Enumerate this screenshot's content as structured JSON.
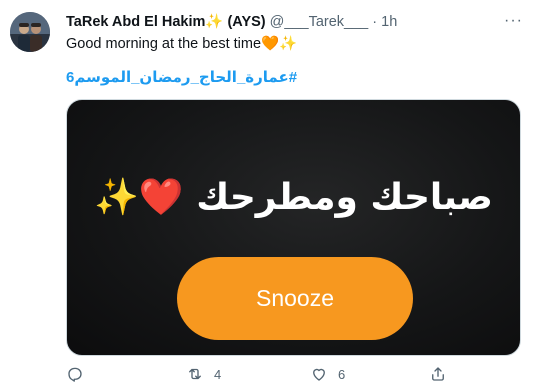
{
  "author": {
    "display_name": "TaRek Abd El Hakim✨ (AYS)",
    "handle": "@___Tarek___",
    "separator": "·",
    "time": "1h"
  },
  "more_label": "···",
  "tweet": {
    "text": "Good morning at the best time🧡✨",
    "hashtag": "#عمارة_الحاج_رمضان_الموسم6"
  },
  "media": {
    "caption": "صباحك ومطرحك ❤️✨",
    "button_label": "Snooze",
    "button_color": "#f7981f"
  },
  "actions": {
    "reply": {
      "icon": "reply-icon",
      "count": ""
    },
    "retweet": {
      "icon": "retweet-icon",
      "count": "4"
    },
    "like": {
      "icon": "heart-icon",
      "count": "6"
    },
    "share": {
      "icon": "share-icon",
      "count": ""
    }
  },
  "colors": {
    "accent": "#1d9bf0",
    "muted": "#536471",
    "text": "#0f1419"
  }
}
